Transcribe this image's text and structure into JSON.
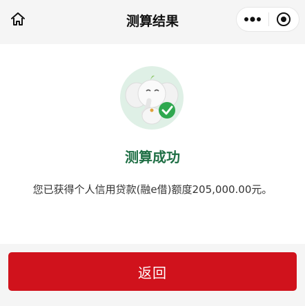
{
  "header": {
    "title": "测算结果",
    "home_icon": "home-icon",
    "more_icon": "more-dots-icon",
    "target_icon": "record-target-icon"
  },
  "result": {
    "title": "测算成功",
    "description": "您已获得个人信用贷款(融e借)额度205,000.00元。",
    "mascot": "elephant-mascot-with-check"
  },
  "actions": {
    "return_label": "返回"
  },
  "colors": {
    "accent_red": "#d0121c",
    "success_green": "#1f6f45",
    "check_green": "#2fa84f",
    "background": "#f5f5f5"
  }
}
